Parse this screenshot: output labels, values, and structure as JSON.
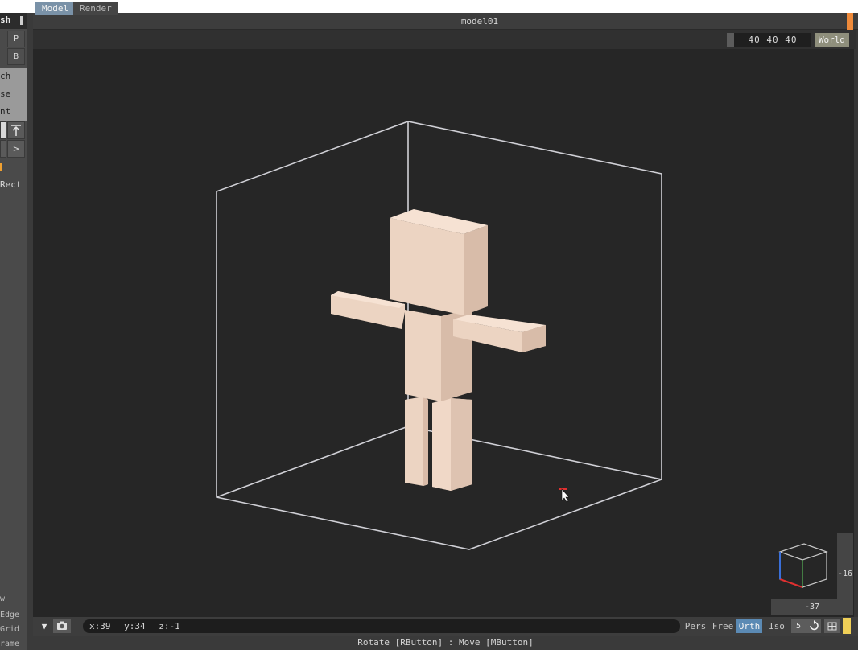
{
  "left_panel": {
    "header": "sh",
    "buttons": [
      "P",
      "B"
    ],
    "menu": [
      "ch",
      "se",
      "nt"
    ],
    "arrow_right": ">",
    "rect_label": "Rect",
    "bottom_labels": [
      "w",
      "Edge",
      "Grid",
      "rame"
    ]
  },
  "tabs": [
    "Model",
    "Render"
  ],
  "title": "model01",
  "toolbar": {
    "size": "40 40 40",
    "space": "World"
  },
  "viewport": {
    "model": "voxel humanoid figure in bounding box",
    "colors": {
      "background": "#262626",
      "voxel_light": "#ecd4c2",
      "voxel_side": "#d9bba8",
      "voxel_top": "#f5e1d2",
      "bounds": "#d0d0d6"
    }
  },
  "sliders": {
    "right_value": "-16",
    "bottom_value": "-37"
  },
  "status": {
    "x": "x:39",
    "y": "y:34",
    "z": "z:-1",
    "modes": [
      "Pers",
      "Free",
      "Orth",
      "Iso"
    ],
    "active_mode": "Orth",
    "step": "5"
  },
  "hint": "Rotate [RButton] : Move [MButton]"
}
